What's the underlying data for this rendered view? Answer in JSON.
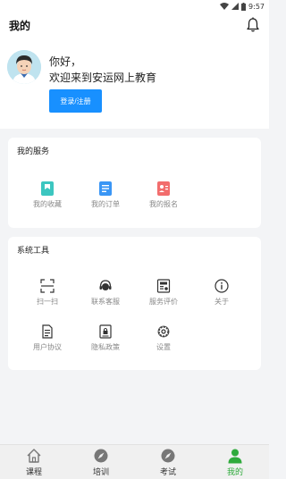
{
  "status_bar": {
    "time": "9:57"
  },
  "header": {
    "title": "我的"
  },
  "profile": {
    "greeting": "你好，",
    "welcome": "欢迎来到安运网上教育",
    "login_button": "登录/注册"
  },
  "services": {
    "title": "我的服务",
    "items": [
      {
        "label": "我的收藏",
        "icon": "bookmark-icon",
        "color": "#3cc6c0"
      },
      {
        "label": "我的订单",
        "icon": "order-icon",
        "color": "#3a96f5"
      },
      {
        "label": "我的报名",
        "icon": "registration-icon",
        "color": "#f26d6d"
      }
    ]
  },
  "tools": {
    "title": "系统工具",
    "items": [
      {
        "label": "扫一扫",
        "icon": "scan-icon"
      },
      {
        "label": "联系客服",
        "icon": "customer-service-icon"
      },
      {
        "label": "服务评价",
        "icon": "service-review-icon"
      },
      {
        "label": "关于",
        "icon": "info-icon"
      },
      {
        "label": "用户协议",
        "icon": "user-agreement-icon"
      },
      {
        "label": "隐私政策",
        "icon": "privacy-policy-icon"
      },
      {
        "label": "设置",
        "icon": "settings-icon"
      }
    ]
  },
  "tabbar": {
    "items": [
      {
        "label": "课程",
        "icon": "home-icon"
      },
      {
        "label": "培训",
        "icon": "compass-icon"
      },
      {
        "label": "考试",
        "icon": "compass-icon"
      },
      {
        "label": "我的",
        "icon": "user-icon"
      }
    ],
    "active_color": "#2faa3c"
  },
  "colors": {
    "accent": "#1890ff",
    "background": "#f3f4f6"
  }
}
